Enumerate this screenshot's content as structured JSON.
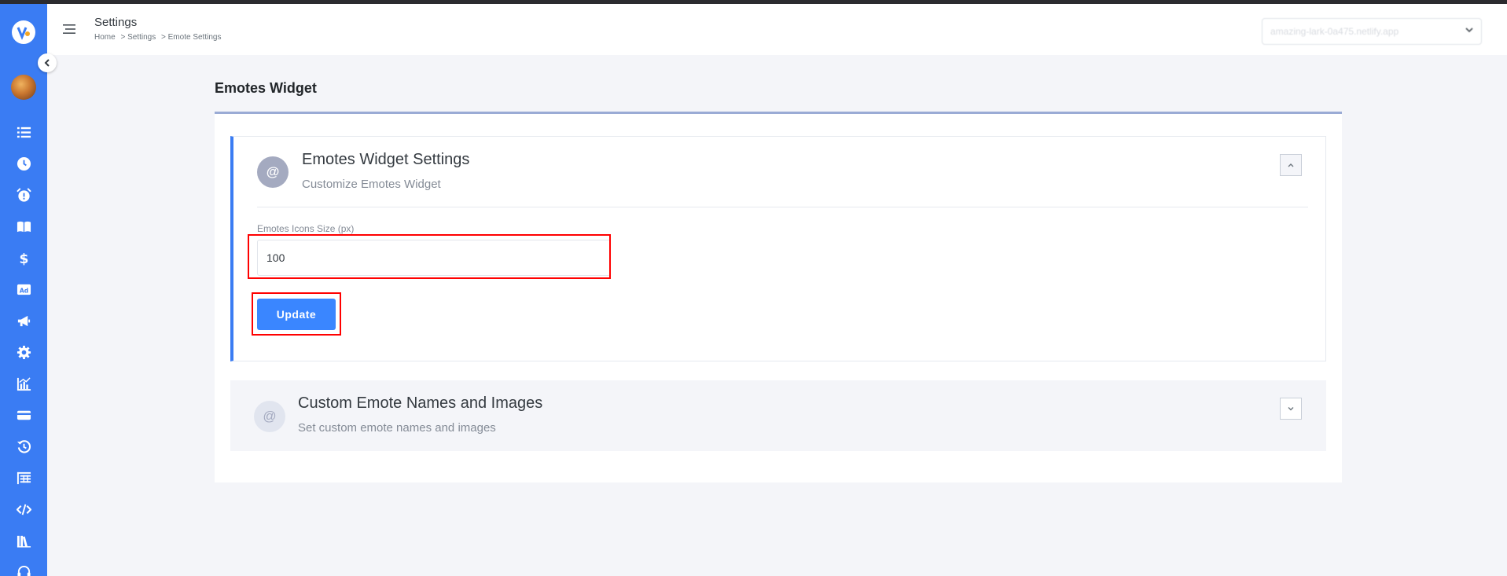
{
  "header": {
    "title": "Settings",
    "breadcrumb": [
      "Home",
      "> Settings",
      "> Emote Settings"
    ],
    "site_select_value": "amazing-lark-0a475.netlify.app"
  },
  "main": {
    "title": "Emotes Widget",
    "panels": [
      {
        "icon_glyph": "@",
        "title": "Emotes Widget Settings",
        "subtitle": "Customize Emotes Widget",
        "field_label": "Emotes Icons Size (px)",
        "field_value": "100",
        "button_label": "Update",
        "expanded": true
      },
      {
        "icon_glyph": "@",
        "title": "Custom Emote Names and Images",
        "subtitle": "Set custom emote names and images",
        "expanded": false
      }
    ]
  },
  "sidebar": {
    "icons": [
      "list-icon",
      "clock-icon",
      "alarm-icon",
      "book-icon",
      "dollar-icon",
      "ad-icon",
      "megaphone-icon",
      "gear-icon",
      "chart-icon",
      "credit-card-icon",
      "history-icon",
      "table-icon",
      "code-icon",
      "library-icon",
      "headset-icon"
    ]
  },
  "colors": {
    "sidebar": "#3a7cf3",
    "primary_button": "#3a86ff",
    "highlight": "#ff0000",
    "card_accent": "#9aabd5"
  }
}
